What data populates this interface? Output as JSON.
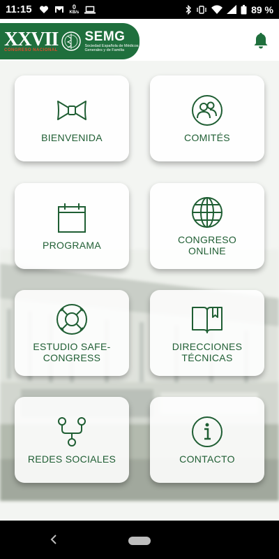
{
  "status_bar": {
    "time": "11:15",
    "net_speed_value": "0",
    "net_speed_unit": "KB/s",
    "battery_percent": "89 %"
  },
  "header": {
    "logo": {
      "roman": "XXVII",
      "congress_text": "CONGRESO NACIONAL",
      "org_short": "SEMG",
      "org_line1": "Sociedad Española de Médicos",
      "org_line2": "Generales y de Familia"
    }
  },
  "tiles": [
    {
      "label": "BIENVENIDA",
      "icon": "bowtie-icon"
    },
    {
      "label": "COMITÉS",
      "icon": "people-icon"
    },
    {
      "label": "PROGRAMA",
      "icon": "calendar-icon"
    },
    {
      "label_line1": "CONGRESO",
      "label_line2": "ONLINE",
      "icon": "globe-icon"
    },
    {
      "label_line1": "ESTUDIO SAFE-",
      "label_line2": "CONGRESS",
      "icon": "lifebuoy-icon"
    },
    {
      "label_line1": "DIRECCIONES",
      "label_line2": "TÉCNICAS",
      "icon": "book-icon"
    },
    {
      "label": "REDES SOCIALES",
      "icon": "network-icon"
    },
    {
      "label": "CONTACTO",
      "icon": "info-icon"
    }
  ],
  "colors": {
    "brand_green": "#1f6f3d",
    "label_green": "#1f5e33",
    "logo_accent": "#e24a2a"
  }
}
